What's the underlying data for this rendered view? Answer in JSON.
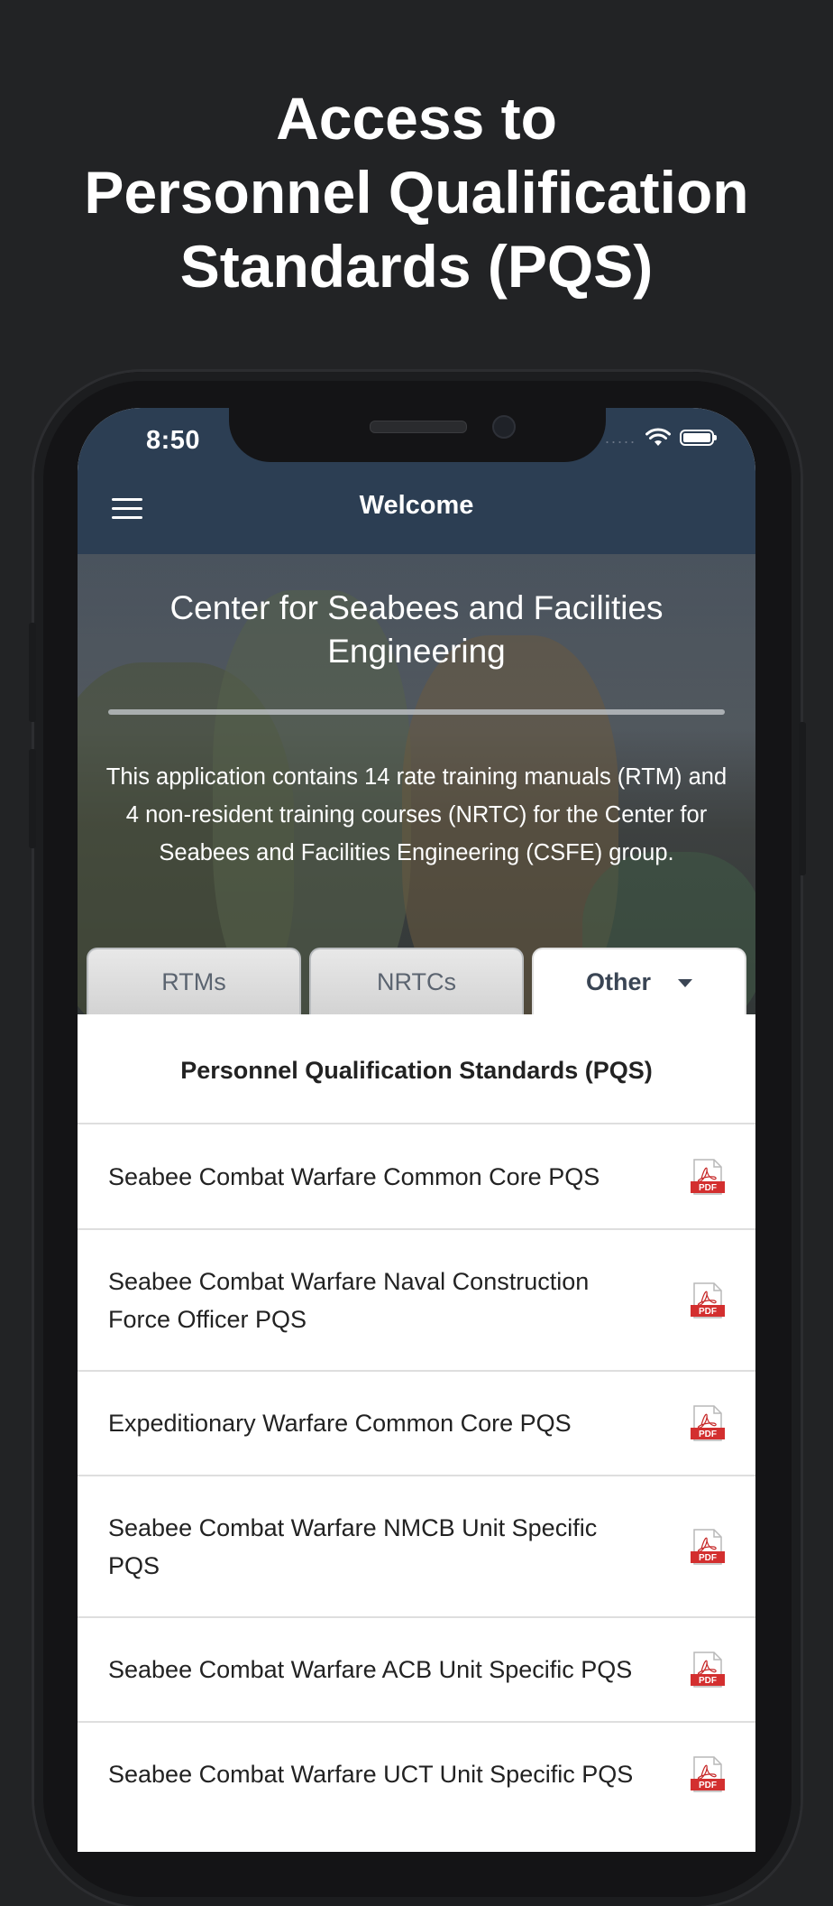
{
  "headline": {
    "line1": "Access to",
    "line2": "Personnel Qualification",
    "line3": "Standards (PQS)"
  },
  "status_bar": {
    "time": "8:50",
    "signal_dots": "....."
  },
  "nav": {
    "title": "Welcome"
  },
  "hero": {
    "title": "Center for Seabees and Facilities Engineering",
    "description": "This application contains 14 rate training manuals (RTM) and 4 non-resident training courses (NRTC) for the Center for Seabees and Facilities Engineering (CSFE) group."
  },
  "tabs": [
    {
      "label": "RTMs"
    },
    {
      "label": "NRTCs"
    },
    {
      "label": "Other"
    }
  ],
  "section": {
    "title": "Personnel Qualification Standards (PQS)"
  },
  "documents": [
    {
      "label": "Seabee Combat Warfare Common Core PQS",
      "icon": "pdf-icon"
    },
    {
      "label": "Seabee Combat Warfare Naval Construction Force Officer PQS",
      "icon": "pdf-icon"
    },
    {
      "label": "Expeditionary Warfare Common Core PQS",
      "icon": "pdf-icon"
    },
    {
      "label": "Seabee Combat Warfare NMCB Unit Specific PQS",
      "icon": "pdf-icon"
    },
    {
      "label": "Seabee Combat Warfare ACB Unit Specific PQS",
      "icon": "pdf-icon"
    },
    {
      "label": "Seabee Combat Warfare UCT Unit Specific PQS",
      "icon": "pdf-icon"
    }
  ],
  "colors": {
    "background": "#222325",
    "navbar": "#2c3e53",
    "pdf_red": "#d32f2f"
  }
}
